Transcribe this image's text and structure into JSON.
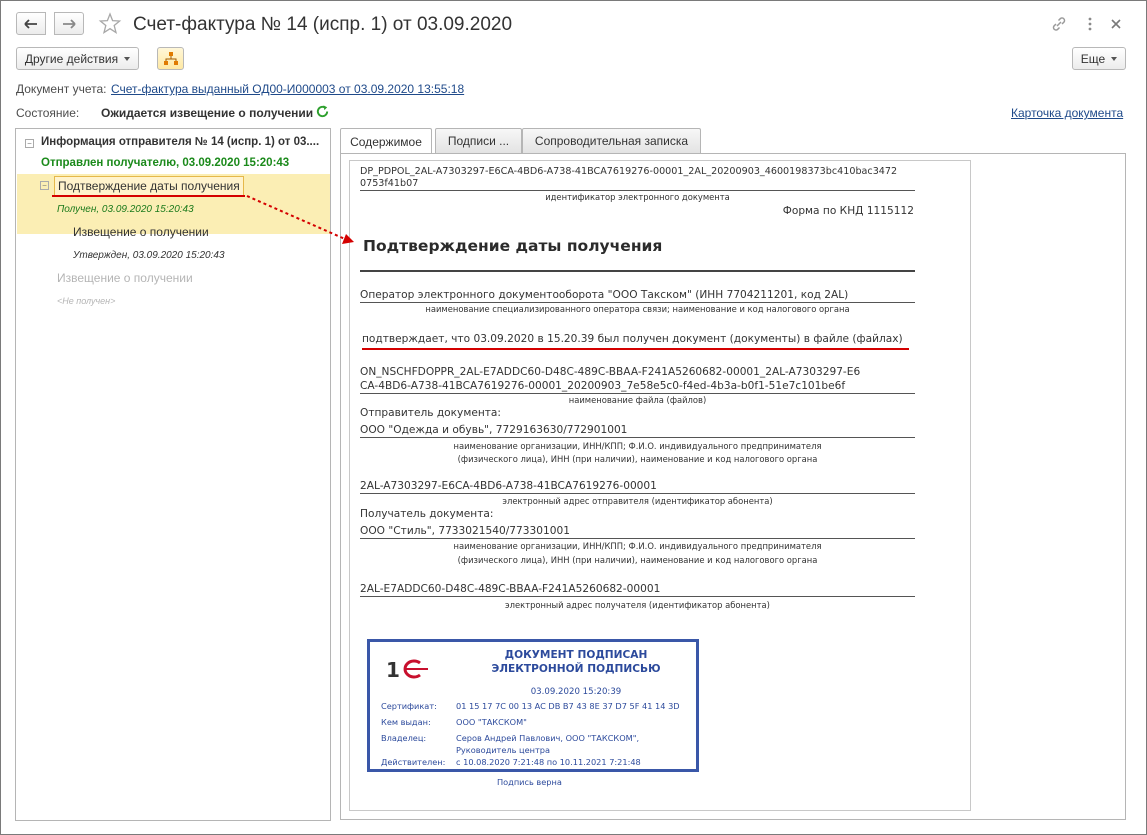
{
  "window": {
    "title": "Счет-фактура № 14 (испр. 1) от 03.09.2020"
  },
  "toolbar": {
    "other_actions": "Другие действия",
    "more": "Еще"
  },
  "doc_row": {
    "label": "Документ учета:",
    "link": "Счет-фактура выданный ОД00-И000003 от 03.09.2020 13:55:18"
  },
  "state_row": {
    "label": "Состояние:",
    "value": "Ожидается извещение о получении",
    "card_link": "Карточка документа"
  },
  "tree": {
    "root_label": "Информация отправителя № 14 (испр. 1) от 03....",
    "root_status": "Отправлен получателю, 03.09.2020 15:20:43",
    "items": [
      {
        "label": "Подтверждение даты получения",
        "status": "Получен, 03.09.2020 15:20:43"
      },
      {
        "label": "Извещение о получении",
        "status": "Утвержден, 03.09.2020 15:20:43"
      },
      {
        "label": "Извещение о получении",
        "status": "<Не получен>"
      }
    ]
  },
  "tabs": [
    {
      "label": "Содержимое"
    },
    {
      "label": "Подписи ..."
    },
    {
      "label": "Сопроводительная записка"
    }
  ],
  "document": {
    "file_id_line1": "DP_PDPOL_2AL-A7303297-E6CA-4BD6-A738-41BCA7619276-00001_2AL_20200903_4600198373bc410bac3472",
    "file_id_line2": "0753f41b07",
    "file_id_caption": "идентификатор электронного документа",
    "form_code": "Форма по КНД 1115112",
    "heading": "Подтверждение даты получения",
    "operator": "Оператор электронного документооборота \"ООО Такском\" (ИНН 7704211201, код 2AL)",
    "operator_caption": "наименование специализированного оператора связи; наименование и код налогового органа",
    "confirms": "подтверждает, что 03.09.2020 в 15.20.39 был получен документ  (документы) в файле (файлах)",
    "filename_line1": "ON_NSCHFDOPPR_2AL-E7ADDC60-D48C-489C-BBAA-F241A5260682-00001_2AL-A7303297-E6",
    "filename_line2": "CA-4BD6-A738-41BCA7619276-00001_20200903_7e58e5c0-f4ed-4b3a-b0f1-51e7c101be6f",
    "filename_caption": "наименование файла (файлов)",
    "sender_label": "Отправитель документа:",
    "sender_value": "ООО \"Одежда и обувь\", 7729163630/772901001",
    "org_caption_1": "наименование организации, ИНН/КПП; Ф.И.О. индивидуального предпринимателя",
    "org_caption_2": "(физического лица), ИНН (при наличии), наименование и код налогового органа",
    "sender_address": "2AL-A7303297-E6CA-4BD6-A738-41BCA7619276-00001",
    "sender_address_caption": "электронный адрес отправителя (идентификатор абонента)",
    "receiver_label": "Получатель документа:",
    "receiver_value": "ООО \"Стиль\", 7733021540/773301001",
    "receiver_caption_1": "наименование организации, ИНН/КПП; Ф.И.О. индивидуального предпринимателя",
    "receiver_caption_2": "(физического лица), ИНН (при наличии), наименование и код налогового органа",
    "receiver_address": "2AL-E7ADDC60-D48C-489C-BBAA-F241A5260682-00001",
    "receiver_address_caption": "электронный адрес получателя (идентификатор абонента)"
  },
  "stamp": {
    "logo_text": "1С",
    "title_1": "ДОКУМЕНТ ПОДПИСАН",
    "title_2": "ЭЛЕКТРОННОЙ ПОДПИСЬЮ",
    "datetime": "03.09.2020 15:20:39",
    "cert_label": "Сертификат:",
    "cert_value": "01 15 17 7C 00 13 AC DB B7 43 8E 37 D7 5F 41 14 3D",
    "issuer_label": "Кем выдан:",
    "issuer_value": "ООО \"ТАКСКОМ\"",
    "owner_label": "Владелец:",
    "owner_value_1": "Серов Андрей Павлович, ООО \"ТАКСКОМ\",",
    "owner_value_2": "Руководитель центра",
    "valid_label": "Действителен:",
    "valid_value": "с 10.08.2020 7:21:48 по 10.11.2021 7:21:48",
    "signature_ok": "Подпись верна"
  },
  "colors": {
    "link": "#1f4a8a",
    "green_status": "#1b8a1b",
    "selection": "#fbeeb4",
    "stamp_blue": "#3a57a8",
    "annotation_red": "#d40000"
  }
}
